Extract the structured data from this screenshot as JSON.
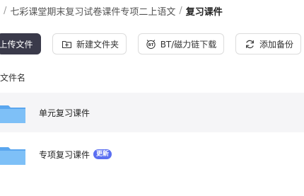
{
  "breadcrumb": {
    "sep": "/",
    "parent": "七彩课堂期末复习试卷课件专项二上语文",
    "current": "复习课件"
  },
  "toolbar": {
    "upload_label": "上传文件",
    "new_folder_label": "新建文件夹",
    "bt_download_label": "BT/磁力链下载",
    "add_backup_label": "添加备份"
  },
  "table": {
    "column_name": "文件名"
  },
  "files": [
    {
      "name": "单元复习课件",
      "type": "folder",
      "badge": ""
    },
    {
      "name": "专项复习课件",
      "type": "folder",
      "badge": "更新"
    }
  ],
  "colors": {
    "primary_button": "#3a3a4a",
    "folder": "#6fb6f5",
    "badge": "#5b6ff1",
    "row_hover": "#f5f5f7"
  }
}
